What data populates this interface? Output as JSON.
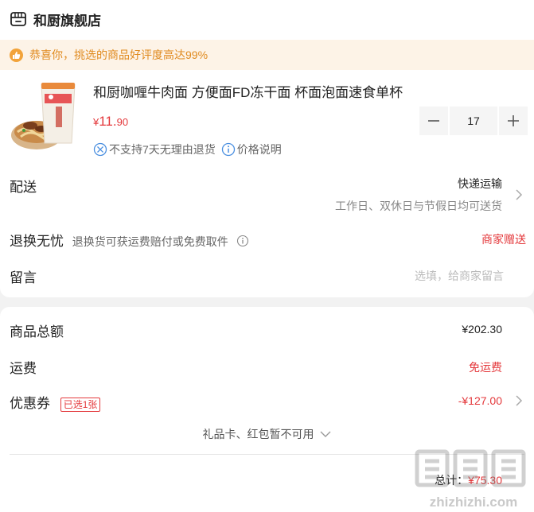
{
  "shop": {
    "name": "和厨旗舰店",
    "icon": "store-icon"
  },
  "praise": {
    "text": "恭喜你，挑选的商品好评度高达99%",
    "color": "#e08a1e",
    "icon": "thumbs-up-icon"
  },
  "product": {
    "title": "和厨咖喱牛肉面 方便面FD冻干面 杯面泡面速食单杯",
    "price_symbol": "¥",
    "price_int": "11.",
    "price_dec": "90",
    "quantity": "17",
    "tags": [
      {
        "icon": "no-return-icon",
        "label": "不支持7天无理由退货"
      },
      {
        "icon": "info-icon",
        "label": "价格说明"
      }
    ]
  },
  "delivery": {
    "label": "配送",
    "method": "快递运输",
    "schedule": "工作日、双休日与节假日均可送货"
  },
  "returns": {
    "label": "退换无忧",
    "desc": "退换货可获运费赔付或免费取件",
    "value": "商家赠送"
  },
  "message": {
    "label": "留言",
    "placeholder": "选填，给商家留言"
  },
  "summary": {
    "goods_total_label": "商品总额",
    "goods_total": "¥202.30",
    "shipping_label": "运费",
    "shipping": "免运费",
    "coupon_label": "优惠券",
    "coupon_tag": "已选1张",
    "coupon_value": "-¥127.00",
    "giftcard_note": "礼品卡、红包暂不可用",
    "total_label": "总计：",
    "total": "¥75.30"
  },
  "watermark": {
    "site": "zhizhizhi.com"
  },
  "colors": {
    "accent_red": "#e4393c",
    "praise_bg": "#fdf3e7",
    "praise_orange": "#e08a1e"
  }
}
